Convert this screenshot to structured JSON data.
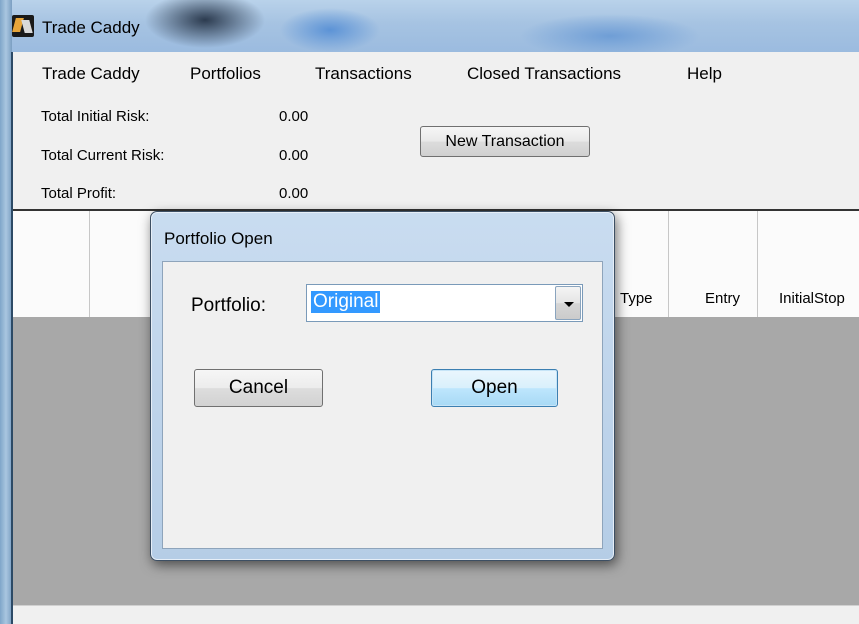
{
  "window": {
    "title": "Trade Caddy",
    "icon": "app-icon"
  },
  "menu": {
    "items": [
      {
        "label": "Trade Caddy"
      },
      {
        "label": "Portfolios"
      },
      {
        "label": "Transactions"
      },
      {
        "label": "Closed Transactions"
      },
      {
        "label": "Help"
      }
    ]
  },
  "summary": {
    "initial_risk_label": "Total Initial  Risk:",
    "initial_risk_value": "0.00",
    "current_risk_label": "Total Current Risk:",
    "current_risk_value": "0.00",
    "profit_label": "Total Profit:",
    "profit_value": "0.00"
  },
  "toolbar": {
    "new_transaction_label": "New Transaction"
  },
  "grid": {
    "columns": [
      "Type",
      "Entry",
      "InitialStop"
    ]
  },
  "dialog": {
    "title": "Portfolio Open",
    "portfolio_label": "Portfolio:",
    "portfolio_value": "Original",
    "cancel_label": "Cancel",
    "open_label": "Open"
  }
}
